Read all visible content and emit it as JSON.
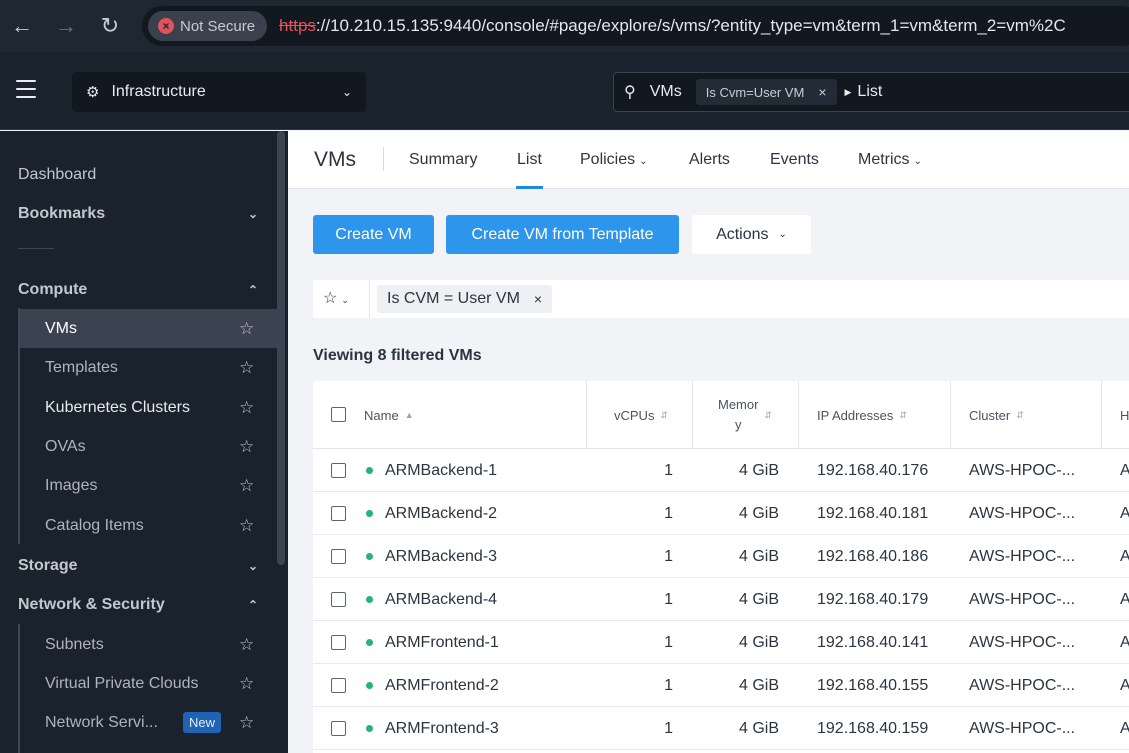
{
  "browser": {
    "security_label": "Not Secure",
    "url_protocol": "https",
    "url_rest": "://10.210.15.135:9440/console/#page/explore/s/vms/?entity_type=vm&term_1=vm&term_2=vm%2C"
  },
  "header": {
    "app_selector": "Infrastructure",
    "search_entity": "VMs",
    "search_chip": "Is Cvm=User VM",
    "search_view": "List"
  },
  "sidebar": {
    "dashboard": "Dashboard",
    "bookmarks": "Bookmarks",
    "compute": "Compute",
    "compute_items": [
      {
        "label": "VMs"
      },
      {
        "label": "Templates"
      },
      {
        "label": "Kubernetes Clusters"
      },
      {
        "label": "OVAs"
      },
      {
        "label": "Images"
      },
      {
        "label": "Catalog Items"
      }
    ],
    "storage": "Storage",
    "network": "Network & Security",
    "network_items": [
      {
        "label": "Subnets"
      },
      {
        "label": "Virtual Private Clouds"
      },
      {
        "label": "Network Servi..."
      }
    ],
    "new_badge": "New"
  },
  "main": {
    "title": "VMs",
    "tabs": [
      {
        "label": "Summary"
      },
      {
        "label": "List"
      },
      {
        "label": "Policies"
      },
      {
        "label": "Alerts"
      },
      {
        "label": "Events"
      },
      {
        "label": "Metrics"
      }
    ],
    "active_tab": "List",
    "buttons": {
      "create_vm": "Create VM",
      "create_from_template": "Create VM from Template",
      "actions": "Actions"
    },
    "filter_chip": "Is CVM = User VM",
    "viewing": "Viewing 8 filtered VMs"
  },
  "table": {
    "columns": {
      "name": "Name",
      "vcpus": "vCPUs",
      "memory_a": "Memor",
      "memory_b": "y",
      "ip": "IP Addresses",
      "cluster": "Cluster",
      "next": "H"
    },
    "rows": [
      {
        "name": "ARMBackend-1",
        "vcpus": "1",
        "memory": "4 GiB",
        "ip": "192.168.40.176",
        "cluster": "AWS-HPOC-...",
        "next": "A"
      },
      {
        "name": "ARMBackend-2",
        "vcpus": "1",
        "memory": "4 GiB",
        "ip": "192.168.40.181",
        "cluster": "AWS-HPOC-...",
        "next": "A"
      },
      {
        "name": "ARMBackend-3",
        "vcpus": "1",
        "memory": "4 GiB",
        "ip": "192.168.40.186",
        "cluster": "AWS-HPOC-...",
        "next": "A"
      },
      {
        "name": "ARMBackend-4",
        "vcpus": "1",
        "memory": "4 GiB",
        "ip": "192.168.40.179",
        "cluster": "AWS-HPOC-...",
        "next": "A"
      },
      {
        "name": "ARMFrontend-1",
        "vcpus": "1",
        "memory": "4 GiB",
        "ip": "192.168.40.141",
        "cluster": "AWS-HPOC-...",
        "next": "A"
      },
      {
        "name": "ARMFrontend-2",
        "vcpus": "1",
        "memory": "4 GiB",
        "ip": "192.168.40.155",
        "cluster": "AWS-HPOC-...",
        "next": "A"
      },
      {
        "name": "ARMFrontend-3",
        "vcpus": "1",
        "memory": "4 GiB",
        "ip": "192.168.40.159",
        "cluster": "AWS-HPOC-...",
        "next": "A"
      }
    ]
  },
  "colors": {
    "accent": "#2d95ec",
    "sidebar_bg": "#1a222d",
    "status_ok": "#22b573"
  }
}
